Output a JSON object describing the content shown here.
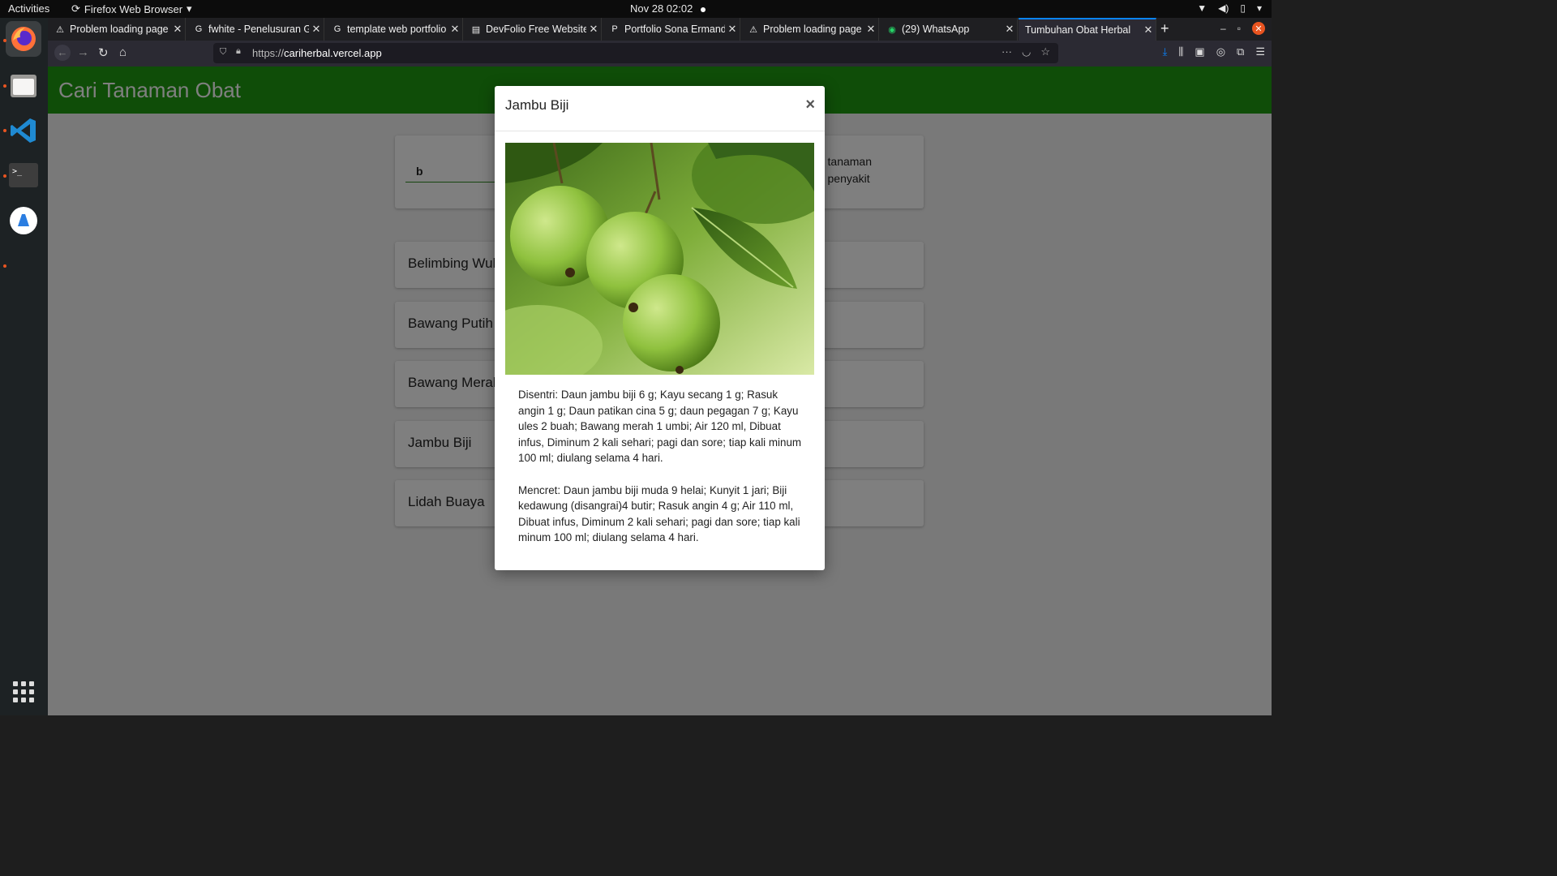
{
  "system": {
    "activities": "Activities",
    "app_menu": "Firefox Web Browser",
    "clock": "Nov 28  02:02"
  },
  "browser": {
    "tabs": [
      {
        "title": "Problem loading page",
        "icon": "warning-icon"
      },
      {
        "title": "fwhite - Penelusuran G",
        "icon": "google-icon"
      },
      {
        "title": "template web portfolio",
        "icon": "google-icon"
      },
      {
        "title": "DevFolio Free Website",
        "icon": "page-icon"
      },
      {
        "title": "Portfolio Sona Ermando",
        "icon": "p-icon"
      },
      {
        "title": "Problem loading page",
        "icon": "warning-icon"
      },
      {
        "title": "(29) WhatsApp",
        "icon": "whatsapp-icon"
      },
      {
        "title": "Tumbuhan Obat Herbal",
        "icon": "none"
      }
    ],
    "url_prefix": "https://",
    "url_host": "cariherbal.vercel.app"
  },
  "page": {
    "brand": "Cari Tanaman Obat",
    "search_value": "b",
    "info_line1": "tanaman",
    "info_line2": "penyakit",
    "plants": [
      "Belimbing Wuluh",
      "Bawang Putih",
      "Bawang Merah",
      "Jambu Biji",
      "Lidah Buaya"
    ]
  },
  "modal": {
    "title": "Jambu Biji",
    "close": "×",
    "paragraphs": [
      "Disentri: Daun jambu biji 6 g; Kayu secang 1 g; Rasuk angin 1 g; Daun patikan cina 5 g; daun pegagan 7 g; Kayu ules 2 buah; Bawang merah 1 umbi; Air 120 ml, Dibuat infus, Diminum 2 kali sehari; pagi dan sore; tiap kali minum 100 ml; diulang selama 4 hari.",
      "Mencret: Daun jambu biji muda 9 helai; Kunyit 1 jari; Biji kedawung (disangrai)4 butir; Rasuk angin 4 g; Air 110 ml, Dibuat infus, Diminum 2 kali sehari; pagi dan sore; tiap kali minum 100 ml; diulang selama 4 hari."
    ]
  },
  "colors": {
    "header_green": "#1f9b11",
    "accent_orange": "#e95420",
    "tab_accent": "#0a84ff"
  }
}
